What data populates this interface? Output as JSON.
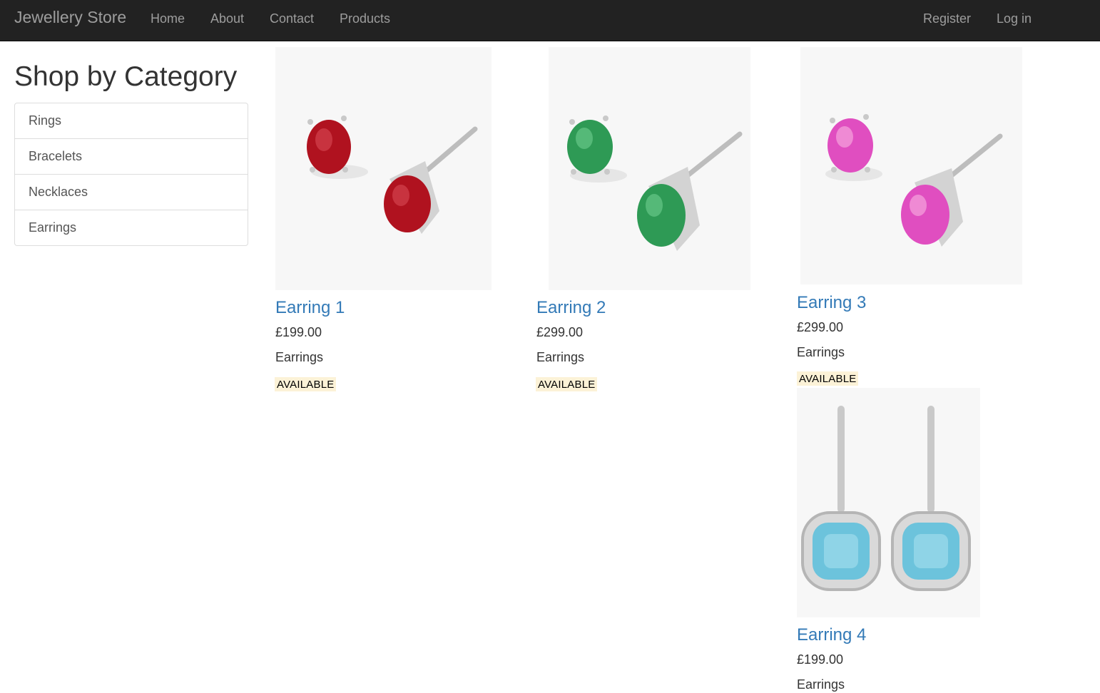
{
  "navbar": {
    "brand": "Jewellery Store",
    "links": [
      "Home",
      "About",
      "Contact",
      "Products"
    ],
    "right_links": [
      "Register",
      "Log in"
    ]
  },
  "sidebar": {
    "title": "Shop by Category",
    "categories": [
      "Rings",
      "Bracelets",
      "Necklaces",
      "Earrings"
    ]
  },
  "products": [
    {
      "name": "Earring 1",
      "price": "£199.00",
      "category": "Earrings",
      "status": "AVAILABLE",
      "image": "ruby-stud-earrings",
      "stone_color": "#b0121f"
    },
    {
      "name": "Earring 2",
      "price": "£299.00",
      "category": "Earrings",
      "status": "AVAILABLE",
      "image": "emerald-stud-earrings",
      "stone_color": "#2e9a55"
    },
    {
      "name": "Earring 3",
      "price": "£299.00",
      "category": "Earrings",
      "status": "AVAILABLE",
      "image": "pink-sapphire-stud-earrings",
      "stone_color": "#e04ec0"
    },
    {
      "name": "Earring 4",
      "price": "£199.00",
      "category": "Earrings",
      "image": "blue-topaz-halo-drop-earrings",
      "stone_color": "#6cc3dc"
    }
  ],
  "colors": {
    "navbar_bg": "#222222",
    "nav_text": "#9d9d9d",
    "link_blue": "#337ab7",
    "badge_bg": "#fcf2d7"
  }
}
